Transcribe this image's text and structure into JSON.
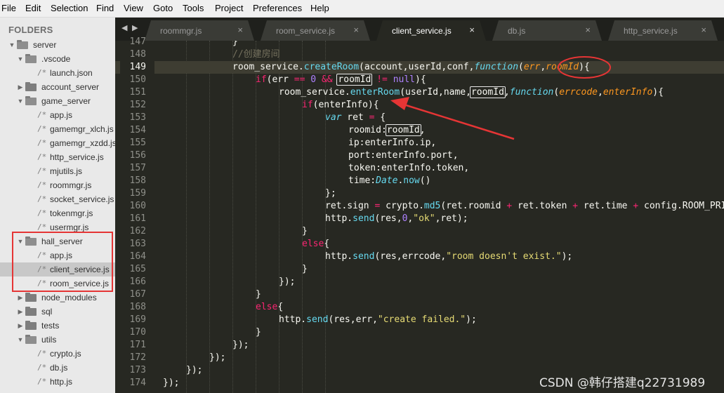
{
  "menu": [
    "File",
    "Edit",
    "Selection",
    "Find",
    "View",
    "Goto",
    "Tools",
    "Project",
    "Preferences",
    "Help"
  ],
  "sidebar": {
    "title": "FOLDERS",
    "tree": [
      {
        "label": "server",
        "type": "folder",
        "open": true,
        "depth": 0
      },
      {
        "label": ".vscode",
        "type": "folder",
        "open": true,
        "depth": 1
      },
      {
        "label": "launch.json",
        "type": "file",
        "depth": 2
      },
      {
        "label": "account_server",
        "type": "folder",
        "open": false,
        "depth": 1
      },
      {
        "label": "game_server",
        "type": "folder",
        "open": true,
        "depth": 1
      },
      {
        "label": "app.js",
        "type": "file",
        "depth": 2
      },
      {
        "label": "gamemgr_xlch.js",
        "type": "file",
        "depth": 2
      },
      {
        "label": "gamemgr_xzdd.js",
        "type": "file",
        "depth": 2
      },
      {
        "label": "http_service.js",
        "type": "file",
        "depth": 2
      },
      {
        "label": "mjutils.js",
        "type": "file",
        "depth": 2
      },
      {
        "label": "roommgr.js",
        "type": "file",
        "depth": 2
      },
      {
        "label": "socket_service.js",
        "type": "file",
        "depth": 2
      },
      {
        "label": "tokenmgr.js",
        "type": "file",
        "depth": 2
      },
      {
        "label": "usermgr.js",
        "type": "file",
        "depth": 2
      },
      {
        "label": "hall_server",
        "type": "folder",
        "open": true,
        "depth": 1
      },
      {
        "label": "app.js",
        "type": "file",
        "depth": 2
      },
      {
        "label": "client_service.js",
        "type": "file",
        "depth": 2,
        "selected": true
      },
      {
        "label": "room_service.js",
        "type": "file",
        "depth": 2
      },
      {
        "label": "node_modules",
        "type": "folder",
        "open": false,
        "depth": 1
      },
      {
        "label": "sql",
        "type": "folder",
        "open": false,
        "depth": 1
      },
      {
        "label": "tests",
        "type": "folder",
        "open": false,
        "depth": 1
      },
      {
        "label": "utils",
        "type": "folder",
        "open": true,
        "depth": 1
      },
      {
        "label": "crypto.js",
        "type": "file",
        "depth": 2
      },
      {
        "label": "db.js",
        "type": "file",
        "depth": 2
      },
      {
        "label": "http.js",
        "type": "file",
        "depth": 2
      }
    ]
  },
  "tabs": [
    {
      "label": "roommgr.js",
      "active": false
    },
    {
      "label": "room_service.js",
      "active": false
    },
    {
      "label": "client_service.js",
      "active": true
    },
    {
      "label": "db.js",
      "active": false
    },
    {
      "label": "http_service.js",
      "active": false
    }
  ],
  "tab_close_glyph": "×",
  "editor": {
    "current_line": 149,
    "lines": [
      {
        "n": 147,
        "indent": 12,
        "tokens": [
          [
            "p",
            "}"
          ]
        ]
      },
      {
        "n": 148,
        "indent": 12,
        "tokens": [
          [
            "cm",
            "//创建房间"
          ]
        ]
      },
      {
        "n": 149,
        "indent": 12,
        "tokens": [
          [
            "p",
            "room_service."
          ],
          [
            "fn",
            "createRoom"
          ],
          [
            "p",
            "(account,userId,conf,"
          ],
          [
            "sk",
            "function"
          ],
          [
            "p",
            "("
          ],
          [
            "pa",
            "err"
          ],
          [
            "p",
            ","
          ],
          [
            "pa",
            "roomId"
          ],
          [
            "p",
            "){"
          ]
        ]
      },
      {
        "n": 150,
        "indent": 16,
        "tokens": [
          [
            "kw",
            "if"
          ],
          [
            "p",
            "(err "
          ],
          [
            "op",
            "=="
          ],
          [
            "p",
            " "
          ],
          [
            "nu",
            "0"
          ],
          [
            "p",
            " "
          ],
          [
            "op",
            "&&"
          ],
          [
            "p",
            " "
          ],
          [
            "bx",
            "roomId"
          ],
          [
            "p",
            " "
          ],
          [
            "op",
            "!="
          ],
          [
            "p",
            " "
          ],
          [
            "nu",
            "null"
          ],
          [
            "p",
            "){"
          ]
        ]
      },
      {
        "n": 151,
        "indent": 20,
        "tokens": [
          [
            "p",
            "room_service."
          ],
          [
            "fn",
            "enterRoom"
          ],
          [
            "p",
            "(userId,name,"
          ],
          [
            "bx",
            "roomId"
          ],
          [
            "p",
            ","
          ],
          [
            "sk",
            "function"
          ],
          [
            "p",
            "("
          ],
          [
            "pa",
            "errcode"
          ],
          [
            "p",
            ","
          ],
          [
            "pa",
            "enterInfo"
          ],
          [
            "p",
            "){"
          ]
        ]
      },
      {
        "n": 152,
        "indent": 24,
        "tokens": [
          [
            "kw",
            "if"
          ],
          [
            "p",
            "(enterInfo){"
          ]
        ]
      },
      {
        "n": 153,
        "indent": 28,
        "tokens": [
          [
            "sk",
            "var"
          ],
          [
            "p",
            " ret "
          ],
          [
            "op",
            "="
          ],
          [
            "p",
            " {"
          ]
        ]
      },
      {
        "n": 154,
        "indent": 32,
        "tokens": [
          [
            "p",
            "roomid:"
          ],
          [
            "bx",
            "roomId"
          ],
          [
            "p",
            ","
          ]
        ]
      },
      {
        "n": 155,
        "indent": 32,
        "tokens": [
          [
            "p",
            "ip:enterInfo.ip,"
          ]
        ]
      },
      {
        "n": 156,
        "indent": 32,
        "tokens": [
          [
            "p",
            "port:enterInfo.port,"
          ]
        ]
      },
      {
        "n": 157,
        "indent": 32,
        "tokens": [
          [
            "p",
            "token:enterInfo.token,"
          ]
        ]
      },
      {
        "n": 158,
        "indent": 32,
        "tokens": [
          [
            "p",
            "time:"
          ],
          [
            "sk",
            "Date"
          ],
          [
            "p",
            "."
          ],
          [
            "fn",
            "now"
          ],
          [
            "p",
            "()"
          ]
        ]
      },
      {
        "n": 159,
        "indent": 28,
        "tokens": [
          [
            "p",
            "};"
          ]
        ]
      },
      {
        "n": 160,
        "indent": 28,
        "tokens": [
          [
            "p",
            "ret.sign "
          ],
          [
            "op",
            "="
          ],
          [
            "p",
            " crypto."
          ],
          [
            "fn",
            "md5"
          ],
          [
            "p",
            "(ret.roomid "
          ],
          [
            "op",
            "+"
          ],
          [
            "p",
            " ret.token "
          ],
          [
            "op",
            "+"
          ],
          [
            "p",
            " ret.time "
          ],
          [
            "op",
            "+"
          ],
          [
            "p",
            " config.ROOM_PRI_KEY);"
          ]
        ]
      },
      {
        "n": 161,
        "indent": 28,
        "tokens": [
          [
            "p",
            "http."
          ],
          [
            "fn",
            "send"
          ],
          [
            "p",
            "(res,"
          ],
          [
            "nu",
            "0"
          ],
          [
            "p",
            ","
          ],
          [
            "st",
            "\"ok\""
          ],
          [
            "p",
            ",ret);"
          ]
        ]
      },
      {
        "n": 162,
        "indent": 24,
        "tokens": [
          [
            "p",
            "}"
          ]
        ]
      },
      {
        "n": 163,
        "indent": 24,
        "tokens": [
          [
            "kw",
            "else"
          ],
          [
            "p",
            "{"
          ]
        ]
      },
      {
        "n": 164,
        "indent": 28,
        "tokens": [
          [
            "p",
            "http."
          ],
          [
            "fn",
            "send"
          ],
          [
            "p",
            "(res,errcode,"
          ],
          [
            "st",
            "\"room doesn't exist.\""
          ],
          [
            "p",
            ");"
          ]
        ]
      },
      {
        "n": 165,
        "indent": 24,
        "tokens": [
          [
            "p",
            "}"
          ]
        ]
      },
      {
        "n": 166,
        "indent": 20,
        "tokens": [
          [
            "p",
            "});"
          ]
        ]
      },
      {
        "n": 167,
        "indent": 16,
        "tokens": [
          [
            "p",
            "}"
          ]
        ]
      },
      {
        "n": 168,
        "indent": 16,
        "tokens": [
          [
            "kw",
            "else"
          ],
          [
            "p",
            "{"
          ]
        ]
      },
      {
        "n": 169,
        "indent": 20,
        "tokens": [
          [
            "p",
            "http."
          ],
          [
            "fn",
            "send"
          ],
          [
            "p",
            "(res,err,"
          ],
          [
            "st",
            "\"create failed.\""
          ],
          [
            "p",
            ");"
          ]
        ]
      },
      {
        "n": 170,
        "indent": 16,
        "tokens": [
          [
            "p",
            "}"
          ]
        ]
      },
      {
        "n": 171,
        "indent": 12,
        "tokens": [
          [
            "p",
            "});"
          ]
        ]
      },
      {
        "n": 172,
        "indent": 8,
        "tokens": [
          [
            "p",
            "});"
          ]
        ]
      },
      {
        "n": 173,
        "indent": 4,
        "tokens": [
          [
            "p",
            "});"
          ]
        ]
      },
      {
        "n": 174,
        "indent": 0,
        "tokens": [
          [
            "p",
            "});"
          ]
        ]
      }
    ]
  },
  "annotation_color": "#e53535",
  "watermark": "CSDN @韩仔搭建q22731989"
}
